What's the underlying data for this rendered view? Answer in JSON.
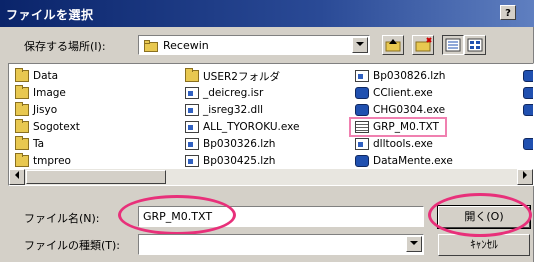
{
  "window": {
    "title": "ファイルを選択",
    "help_label": "?"
  },
  "look_in": {
    "label": "保存する場所(I):",
    "value": "Recewin"
  },
  "files": [
    {
      "name": "Data",
      "type": "folder"
    },
    {
      "name": "Image",
      "type": "folder"
    },
    {
      "name": "Jisyo",
      "type": "folder"
    },
    {
      "name": "Sogotext",
      "type": "folder"
    },
    {
      "name": "Ta",
      "type": "folder"
    },
    {
      "name": "tmpreo",
      "type": "folder"
    },
    {
      "name": "USER2フォルダ",
      "type": "folder"
    },
    {
      "name": "_deicreg.isr",
      "type": "doc"
    },
    {
      "name": "_isreg32.dll",
      "type": "doc"
    },
    {
      "name": "ALL_TYOROKU.exe",
      "type": "doc"
    },
    {
      "name": "Bp030326.lzh",
      "type": "doc"
    },
    {
      "name": "Bp030425.lzh",
      "type": "doc"
    },
    {
      "name": "Bp030826.lzh",
      "type": "doc"
    },
    {
      "name": "CClient.exe",
      "type": "exe"
    },
    {
      "name": "CHG0304.exe",
      "type": "exe"
    },
    {
      "name": "GRP_M0.TXT",
      "type": "text"
    },
    {
      "name": "dlltools.exe",
      "type": "doc"
    },
    {
      "name": "DataMente.exe",
      "type": "exe"
    }
  ],
  "filename": {
    "label": "ファイル名(N):",
    "value": "GRP_M0.TXT"
  },
  "filetype": {
    "label": "ファイルの種類(T):",
    "value": ""
  },
  "buttons": {
    "open": "開く(O)",
    "cancel": "ｷｬﾝｾﾙ"
  },
  "colors": {
    "title_bar": "#0a246a",
    "dialog_face": "#d4d0c8",
    "highlight_annotation": "#e8307a"
  }
}
